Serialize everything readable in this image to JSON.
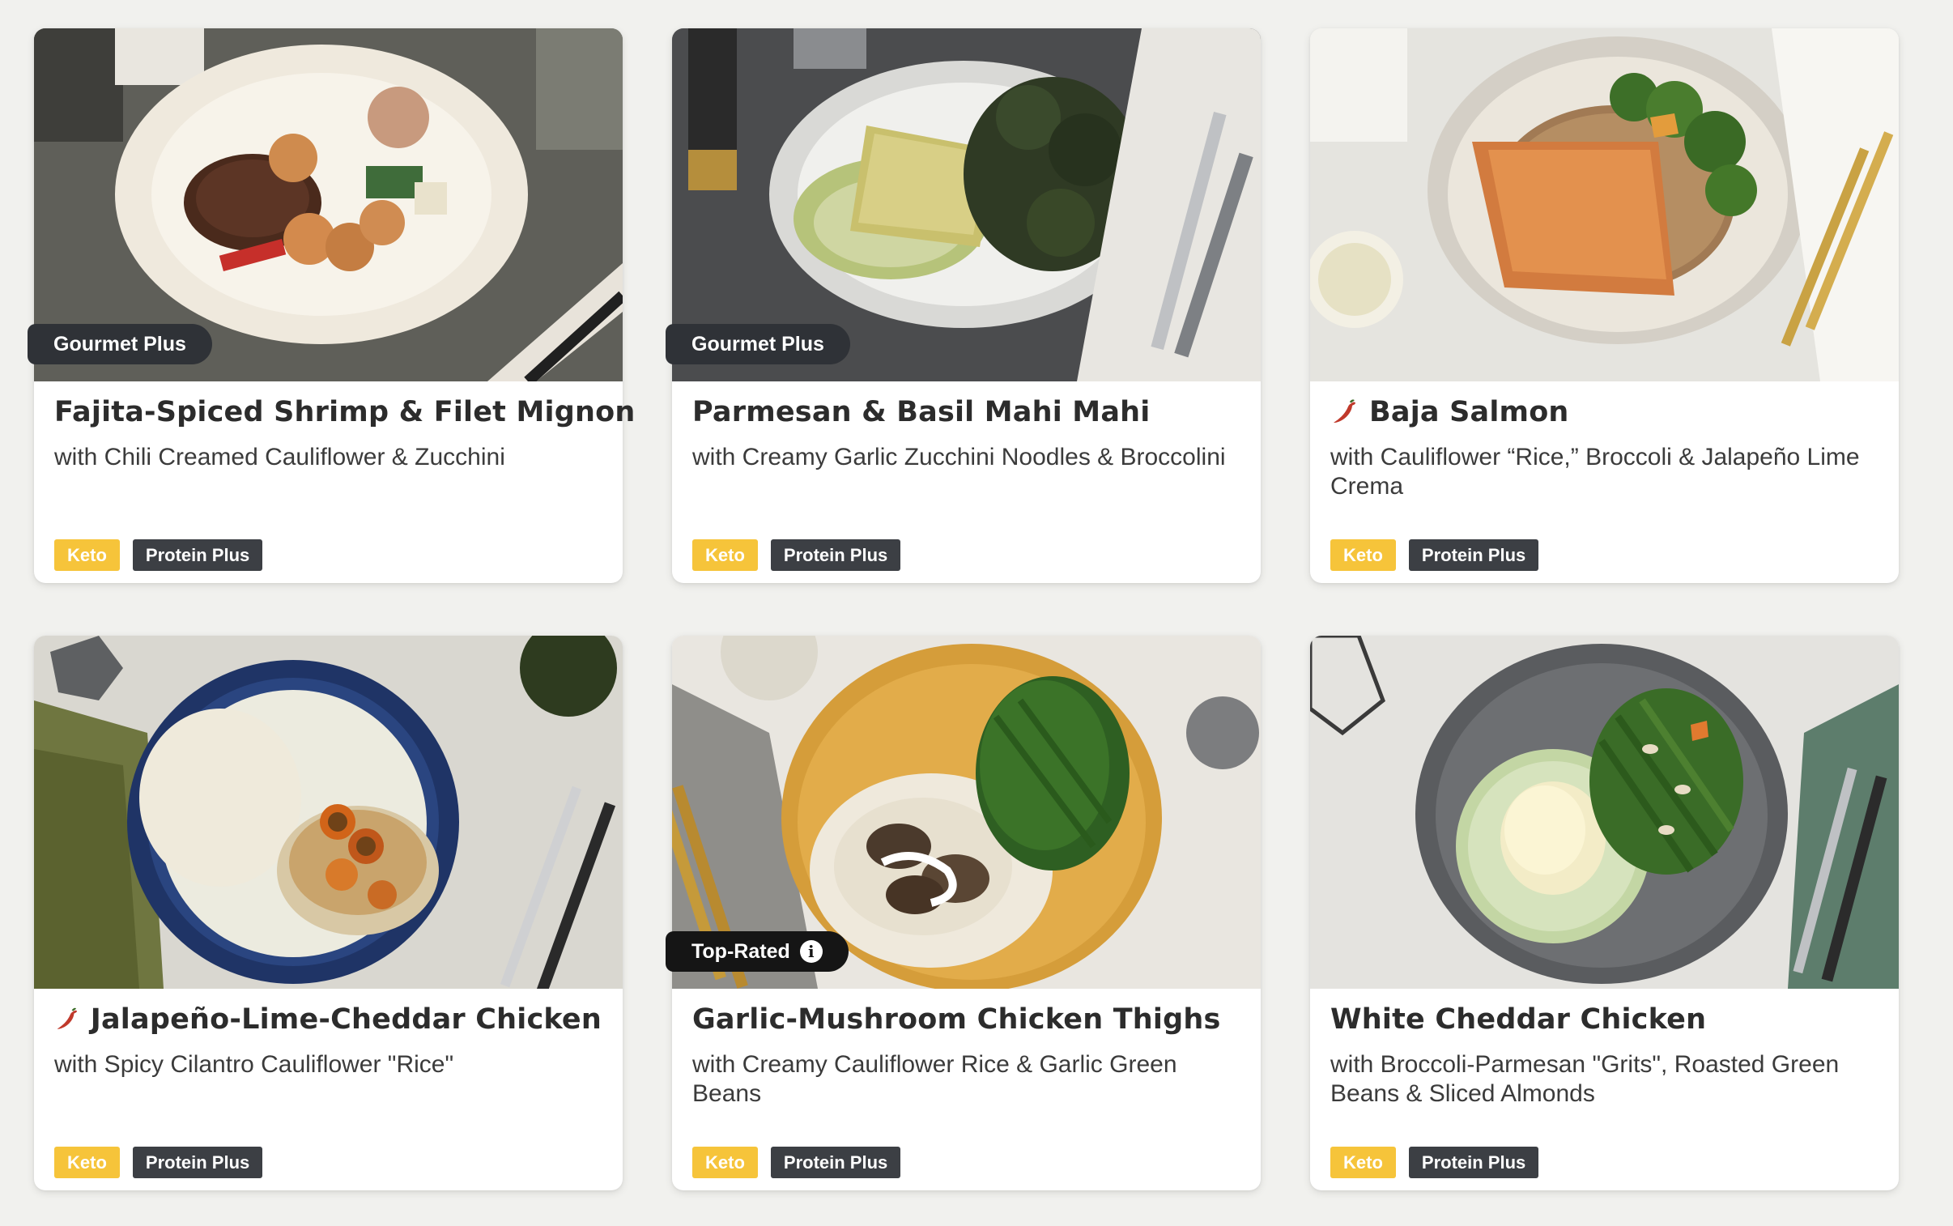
{
  "colors": {
    "page_bg": "#f1f1ee",
    "card_bg": "#ffffff",
    "keto_tag": "#f6c43a",
    "protein_tag": "#3c3f44",
    "ribbon_dark": "#2f3237",
    "ribbon_black": "#151515",
    "pepper": "#c0392b"
  },
  "cards": [
    {
      "ribbon": "Gourmet Plus",
      "spicy": false,
      "title": "Fajita-Spiced Shrimp & Filet Mignon",
      "subtitle": "with Chili Creamed Cauliflower & Zucchini",
      "tags": [
        "Keto",
        "Protein Plus"
      ],
      "image_icon": "plate-steak-shrimp-image"
    },
    {
      "ribbon": "Gourmet Plus",
      "spicy": false,
      "title": "Parmesan & Basil Mahi Mahi",
      "subtitle": "with Creamy Garlic Zucchini Noodles & Broccolini",
      "tags": [
        "Keto",
        "Protein Plus"
      ],
      "image_icon": "plate-fish-broccolini-image"
    },
    {
      "ribbon": "",
      "spicy": true,
      "title": "Baja Salmon",
      "subtitle": "with Cauliflower “Rice,” Broccoli & Jalapeño Lime Crema",
      "tags": [
        "Keto",
        "Protein Plus"
      ],
      "image_icon": "plate-salmon-rice-image"
    },
    {
      "ribbon": "",
      "spicy": true,
      "title": "Jalapeño-Lime-Cheddar Chicken",
      "subtitle": "with Spicy Cilantro Cauliflower \"Rice\"",
      "tags": [
        "Keto",
        "Protein Plus"
      ],
      "image_icon": "plate-chicken-jalapeno-image"
    },
    {
      "ribbon": "Top-Rated",
      "ribbon_info": "i",
      "spicy": false,
      "title": "Garlic-Mushroom Chicken Thighs",
      "subtitle": "with Creamy Cauliflower Rice & Garlic Green Beans",
      "tags": [
        "Keto",
        "Protein Plus"
      ],
      "image_icon": "plate-chicken-mushroom-image"
    },
    {
      "ribbon": "",
      "spicy": false,
      "title": "White Cheddar Chicken",
      "subtitle": "with Broccoli-Parmesan \"Grits\", Roasted Green Beans & Sliced Almonds",
      "tags": [
        "Keto",
        "Protein Plus"
      ],
      "image_icon": "plate-chicken-greenbeans-image"
    }
  ]
}
